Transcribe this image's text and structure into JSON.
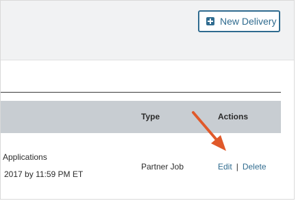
{
  "toolbar": {
    "new_delivery_label": "New Delivery"
  },
  "table": {
    "headers": {
      "type": "Type",
      "actions": "Actions"
    },
    "rows": [
      {
        "title": "Applications",
        "due": "2017 by 11:59 PM ET",
        "type": "Partner Job",
        "actions": {
          "edit": "Edit",
          "separator": "|",
          "delete": "Delete"
        }
      }
    ]
  },
  "colors": {
    "accent": "#2f6b8f",
    "header_bg": "#f1f2f3",
    "table_header_bg": "#c8cdd2",
    "annotation_arrow": "#e0592a"
  },
  "icons": {
    "new_delivery": "plus-square-icon",
    "annotation": "arrow-annotation-icon"
  }
}
